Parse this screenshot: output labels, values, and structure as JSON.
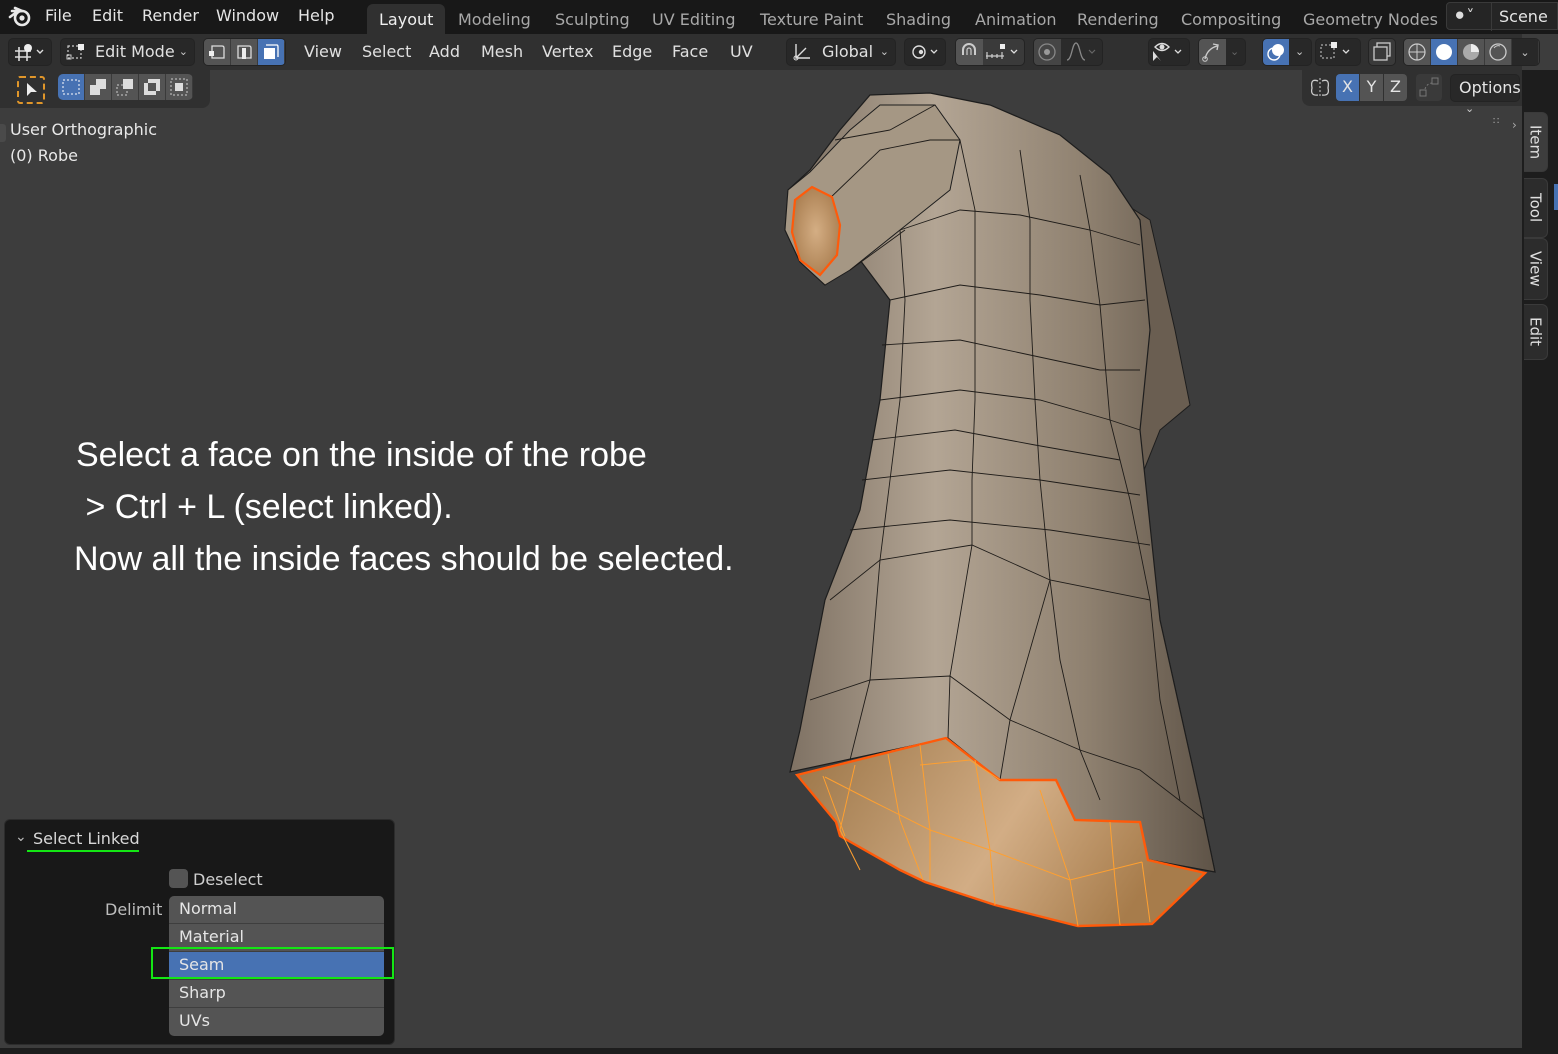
{
  "topbar": {
    "menus": [
      "File",
      "Edit",
      "Render",
      "Window",
      "Help"
    ],
    "workspaces": [
      "Layout",
      "Modeling",
      "Sculpting",
      "UV Editing",
      "Texture Paint",
      "Shading",
      "Animation",
      "Rendering",
      "Compositing",
      "Geometry Nodes"
    ],
    "active_workspace": "Layout",
    "scene_label": "Scene"
  },
  "header": {
    "mode": "Edit Mode",
    "select_modes": [
      "vertex",
      "edge",
      "face"
    ],
    "active_select_mode": "face",
    "menus": [
      "View",
      "Select",
      "Add",
      "Mesh",
      "Vertex",
      "Edge",
      "Face",
      "UV"
    ],
    "transform_orientation": "Global",
    "options_label": "Options",
    "axes": [
      "X",
      "Y",
      "Z"
    ],
    "active_axis": "X"
  },
  "viewport": {
    "view_name": "User Orthographic",
    "object_name": "(0) Robe",
    "instructions": [
      "Select a face on the inside of the robe",
      " > Ctrl + L (select linked).",
      "Now all the inside faces should be selected."
    ],
    "colors": {
      "background": "#3d3d3d",
      "mesh": "#9a8c7c",
      "selection": "#ff7a1a",
      "selected_face": "#c8995f"
    }
  },
  "npanel": {
    "tabs": [
      "Item",
      "Tool",
      "View",
      "Edit"
    ],
    "active_tab": "Item"
  },
  "redo_panel": {
    "title": "Select Linked",
    "deselect_label": "Deselect",
    "deselect_checked": false,
    "delimit_label": "Delimit",
    "delimit_options": [
      "Normal",
      "Material",
      "Seam",
      "Sharp",
      "UVs"
    ],
    "delimit_selected": "Seam"
  }
}
